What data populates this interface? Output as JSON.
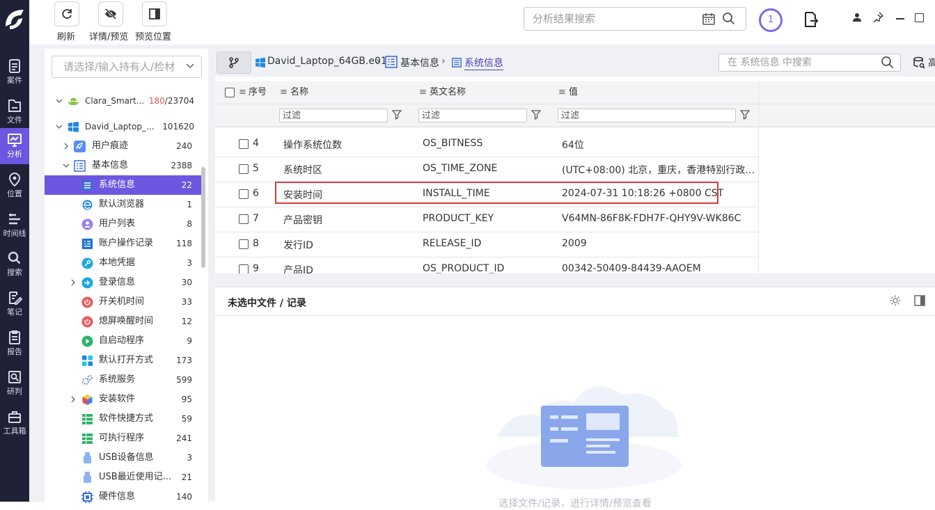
{
  "rail": {
    "items": [
      {
        "label": "案件",
        "icon": "case-icon"
      },
      {
        "label": "文件",
        "icon": "file-icon"
      },
      {
        "label": "分析",
        "icon": "analysis-icon",
        "active": true
      },
      {
        "label": "位置",
        "icon": "location-pin-icon"
      },
      {
        "label": "时间线",
        "icon": "timeline-icon"
      },
      {
        "label": "搜索",
        "icon": "search-icon"
      },
      {
        "label": "笔记",
        "icon": "note-icon"
      },
      {
        "label": "报告",
        "icon": "report-icon"
      },
      {
        "label": "研判",
        "icon": "judge-icon"
      },
      {
        "label": "工具箱",
        "icon": "toolbox-icon"
      }
    ],
    "accent": "#6b57e0",
    "background": "#1f2237"
  },
  "toolbar": {
    "refresh_label": "刷新",
    "detail_preview_label": "详情/预览",
    "preview_position_label": "预览位置",
    "search_placeholder": "分析结果搜索",
    "task_count": "1"
  },
  "tree": {
    "owner_placeholder": "请选择/输入持有人/检材",
    "devices": [
      {
        "name": "Clara_Smart...",
        "count_highlight": "180",
        "count_total": "/23704"
      },
      {
        "name": "David_Laptop_...",
        "count": "101620"
      }
    ],
    "items": [
      {
        "label": "用户痕迹",
        "count": "240"
      },
      {
        "label": "基本信息",
        "count": "2388"
      },
      {
        "label": "系统信息",
        "count": "22"
      },
      {
        "label": "默认浏览器",
        "count": "1"
      },
      {
        "label": "用户列表",
        "count": "8"
      },
      {
        "label": "账户操作记录",
        "count": "118"
      },
      {
        "label": "本地凭据",
        "count": "3"
      },
      {
        "label": "登录信息",
        "count": "30"
      },
      {
        "label": "开关机时间",
        "count": "33"
      },
      {
        "label": "熄屏唤醒时间",
        "count": "12"
      },
      {
        "label": "自启动程序",
        "count": "9"
      },
      {
        "label": "默认打开方式",
        "count": "173"
      },
      {
        "label": "系统服务",
        "count": "599"
      },
      {
        "label": "安装软件",
        "count": "95"
      },
      {
        "label": "软件快捷方式",
        "count": "59"
      },
      {
        "label": "可执行程序",
        "count": "241"
      },
      {
        "label": "USB设备信息",
        "count": "3"
      },
      {
        "label": "USB最近使用记...",
        "count": "21"
      },
      {
        "label": "硬件信息",
        "count": "140"
      }
    ]
  },
  "breadcrumb": {
    "device": "David_Laptop_64GB.e01",
    "category": "基本信息",
    "current": "系统信息",
    "search_placeholder": "在 系统信息 中搜索",
    "extra": "高"
  },
  "table": {
    "headers": {
      "index": "序号",
      "name": "名称",
      "english": "英文名称",
      "value": "值"
    },
    "filter_placeholder": "过滤",
    "rows": [
      {
        "index": "4",
        "name": "操作系统位数",
        "english": "OS_BITNESS",
        "value": "64位"
      },
      {
        "index": "5",
        "name": "系统时区",
        "english": "OS_TIME_ZONE",
        "value": "(UTC+08:00) 北京，重庆，香港特别行政区..."
      },
      {
        "index": "6",
        "name": "安装时间",
        "english": "INSTALL_TIME",
        "value": "2024-07-31 10:18:26 +0800 CST",
        "highlighted": true
      },
      {
        "index": "7",
        "name": "产品密钥",
        "english": "PRODUCT_KEY",
        "value": "V64MN-86F8K-FDH7F-QHY9V-WK86C"
      },
      {
        "index": "8",
        "name": "发行ID",
        "english": "RELEASE_ID",
        "value": "2009"
      },
      {
        "index": "9",
        "name": "产品ID",
        "english": "OS_PRODUCT_ID",
        "value": "00342-50409-84439-AAOEM"
      }
    ],
    "highlight_color": "#d9363e"
  },
  "detail": {
    "title": "未选中文件 / 记录",
    "hint": "选择文件/记录，进行详情/预览查看"
  }
}
